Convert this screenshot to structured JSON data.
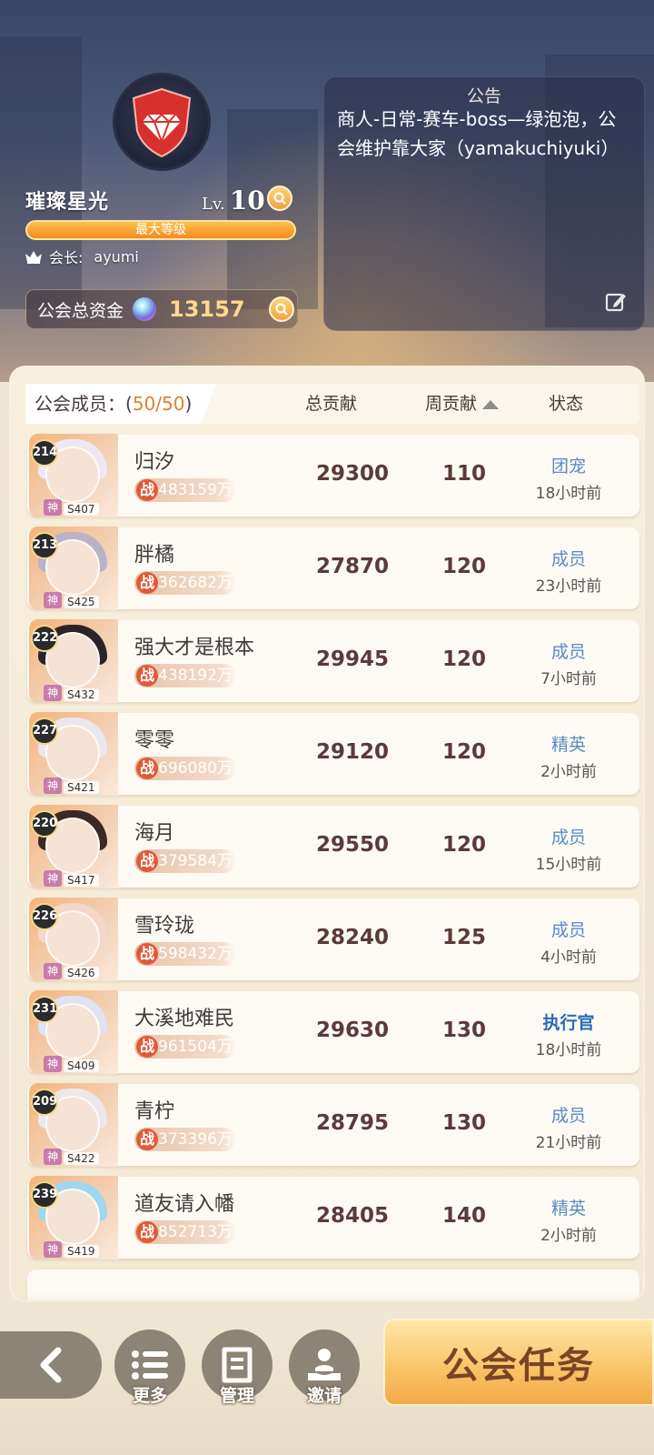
{
  "guild": {
    "name": "璀璨星光",
    "level_prefix": "Lv.",
    "level": "10",
    "level_bar_text": "最大等级",
    "leader_label": "会长:",
    "leader_name": "ayumi",
    "funds_label": "公会总资金",
    "funds_value": "13157"
  },
  "notice": {
    "title": "公告",
    "text": "商人-日常-赛车-boss—绿泡泡，公会维护靠大家（yamakuchiyuki）"
  },
  "members_header": {
    "label": "公会成员：(",
    "count": "50/50",
    "label_close": ")",
    "col_total": "总贡献",
    "col_week": "周贡献",
    "col_status": "状态"
  },
  "members": [
    {
      "level": "214",
      "server": "S407",
      "god_tag": "神",
      "name": "归汐",
      "power_tag": "战",
      "power": "483159万",
      "total": "29300",
      "week": "110",
      "role": "团宠",
      "time": "18小时前",
      "hair_color": "#f1e7f4"
    },
    {
      "level": "213",
      "server": "S425",
      "god_tag": "神",
      "name": "胖橘",
      "power_tag": "战",
      "power": "362682万",
      "total": "27870",
      "week": "120",
      "role": "成员",
      "time": "23小时前",
      "hair_color": "#b9b3c8"
    },
    {
      "level": "222",
      "server": "S432",
      "god_tag": "神",
      "name": "强大才是根本",
      "power_tag": "战",
      "power": "438192万",
      "total": "29945",
      "week": "120",
      "role": "成员",
      "time": "7小时前",
      "hair_color": "#2c2328"
    },
    {
      "level": "227",
      "server": "S421",
      "god_tag": "神",
      "name": "零零",
      "power_tag": "战",
      "power": "696080万",
      "total": "29120",
      "week": "120",
      "role": "精英",
      "time": "2小时前",
      "hair_color": "#ece7ec"
    },
    {
      "level": "220",
      "server": "S417",
      "god_tag": "神",
      "name": "海月",
      "power_tag": "战",
      "power": "379584万",
      "total": "29550",
      "week": "120",
      "role": "成员",
      "time": "15小时前",
      "hair_color": "#3a2a26"
    },
    {
      "level": "226",
      "server": "S426",
      "god_tag": "神",
      "name": "雪玲珑",
      "power_tag": "战",
      "power": "598432万",
      "total": "28240",
      "week": "125",
      "role": "成员",
      "time": "4小时前",
      "hair_color": "#f4d7c8"
    },
    {
      "level": "231",
      "server": "S409",
      "god_tag": "神",
      "name": "大溪地难民",
      "power_tag": "战",
      "power": "961504万",
      "total": "29630",
      "week": "130",
      "role": "执行官",
      "time": "18小时前",
      "hair_color": "#dfe3f2"
    },
    {
      "level": "209",
      "server": "S422",
      "god_tag": "神",
      "name": "青柠",
      "power_tag": "战",
      "power": "373396万",
      "total": "28795",
      "week": "130",
      "role": "成员",
      "time": "21小时前",
      "hair_color": "#eee7ea"
    },
    {
      "level": "239",
      "server": "S419",
      "god_tag": "神",
      "name": "道友请入幡",
      "power_tag": "战",
      "power": "852713万",
      "total": "28405",
      "week": "140",
      "role": "精英",
      "time": "2小时前",
      "hair_color": "#9ed8ef"
    }
  ],
  "bottom": {
    "more_label": "更多",
    "manage_label": "管理",
    "invite_label": "邀请",
    "task_label": "公会任务"
  },
  "colors": {
    "accent_orange": "#f48b1f",
    "role_blue": "#5b8ac4",
    "exec_blue": "#2a6bb8",
    "number_brown": "#5b3a3a"
  },
  "icons": [
    "guild-emblem-icon",
    "search-icon",
    "crown-icon",
    "gem-icon",
    "edit-icon",
    "sort-up-icon",
    "back-arrow-icon",
    "list-icon",
    "manage-icon",
    "invite-icon"
  ]
}
